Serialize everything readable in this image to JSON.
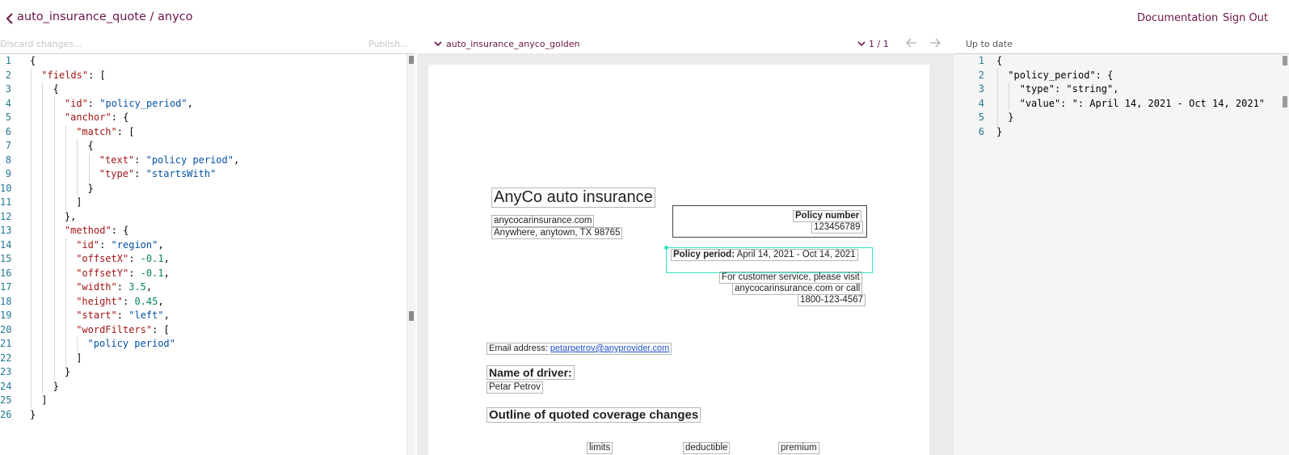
{
  "header": {
    "title": "auto_insurance_quote / anyco",
    "documentation_label": "Documentation",
    "signout_label": "Sign Out"
  },
  "toolbar": {
    "discard_label": "Discard changes...",
    "publish_label": "Publish...",
    "document_name": "auto_insurance_anyco_golden",
    "page_indicator": "1 / 1",
    "status": "Up to date"
  },
  "left_editor": {
    "lines": [
      {
        "n": "1",
        "indent": 0,
        "tokens": [
          [
            "p",
            "{"
          ]
        ]
      },
      {
        "n": "2",
        "indent": 1,
        "tokens": [
          [
            "k",
            "\"fields\""
          ],
          [
            "p",
            ": ["
          ]
        ]
      },
      {
        "n": "3",
        "indent": 2,
        "tokens": [
          [
            "p",
            "{"
          ]
        ]
      },
      {
        "n": "4",
        "indent": 3,
        "tokens": [
          [
            "k",
            "\"id\""
          ],
          [
            "p",
            ": "
          ],
          [
            "s",
            "\"policy_period\""
          ],
          [
            "p",
            ","
          ]
        ]
      },
      {
        "n": "5",
        "indent": 3,
        "tokens": [
          [
            "k",
            "\"anchor\""
          ],
          [
            "p",
            ": {"
          ]
        ]
      },
      {
        "n": "6",
        "indent": 4,
        "tokens": [
          [
            "k",
            "\"match\""
          ],
          [
            "p",
            ": ["
          ]
        ]
      },
      {
        "n": "7",
        "indent": 5,
        "tokens": [
          [
            "p",
            "{"
          ]
        ]
      },
      {
        "n": "8",
        "indent": 6,
        "tokens": [
          [
            "k",
            "\"text\""
          ],
          [
            "p",
            ": "
          ],
          [
            "s",
            "\"policy period\""
          ],
          [
            "p",
            ","
          ]
        ]
      },
      {
        "n": "9",
        "indent": 6,
        "tokens": [
          [
            "k",
            "\"type\""
          ],
          [
            "p",
            ": "
          ],
          [
            "s",
            "\"startsWith\""
          ]
        ]
      },
      {
        "n": "10",
        "indent": 5,
        "tokens": [
          [
            "p",
            "}"
          ]
        ]
      },
      {
        "n": "11",
        "indent": 4,
        "tokens": [
          [
            "p",
            "]"
          ]
        ]
      },
      {
        "n": "12",
        "indent": 3,
        "tokens": [
          [
            "p",
            "},"
          ]
        ]
      },
      {
        "n": "13",
        "indent": 3,
        "tokens": [
          [
            "k",
            "\"method\""
          ],
          [
            "p",
            ": {"
          ]
        ]
      },
      {
        "n": "14",
        "indent": 4,
        "tokens": [
          [
            "k",
            "\"id\""
          ],
          [
            "p",
            ": "
          ],
          [
            "s",
            "\"region\""
          ],
          [
            "p",
            ","
          ]
        ]
      },
      {
        "n": "15",
        "indent": 4,
        "tokens": [
          [
            "k",
            "\"offsetX\""
          ],
          [
            "p",
            ": "
          ],
          [
            "n",
            "-0.1"
          ],
          [
            "p",
            ","
          ]
        ]
      },
      {
        "n": "16",
        "indent": 4,
        "tokens": [
          [
            "k",
            "\"offsetY\""
          ],
          [
            "p",
            ": "
          ],
          [
            "n",
            "-0.1"
          ],
          [
            "p",
            ","
          ]
        ]
      },
      {
        "n": "17",
        "indent": 4,
        "tokens": [
          [
            "k",
            "\"width\""
          ],
          [
            "p",
            ": "
          ],
          [
            "n",
            "3.5"
          ],
          [
            "p",
            ","
          ]
        ]
      },
      {
        "n": "18",
        "indent": 4,
        "tokens": [
          [
            "k",
            "\"height\""
          ],
          [
            "p",
            ": "
          ],
          [
            "n",
            "0.45"
          ],
          [
            "p",
            ","
          ]
        ]
      },
      {
        "n": "19",
        "indent": 4,
        "tokens": [
          [
            "k",
            "\"start\""
          ],
          [
            "p",
            ": "
          ],
          [
            "s",
            "\"left\""
          ],
          [
            "p",
            ","
          ]
        ]
      },
      {
        "n": "20",
        "indent": 4,
        "tokens": [
          [
            "k",
            "\"wordFilters\""
          ],
          [
            "p",
            ": ["
          ]
        ]
      },
      {
        "n": "21",
        "indent": 5,
        "tokens": [
          [
            "s",
            "\"policy period\""
          ]
        ]
      },
      {
        "n": "22",
        "indent": 4,
        "tokens": [
          [
            "p",
            "]"
          ]
        ]
      },
      {
        "n": "23",
        "indent": 3,
        "tokens": [
          [
            "p",
            "}"
          ]
        ]
      },
      {
        "n": "24",
        "indent": 2,
        "tokens": [
          [
            "p",
            "}"
          ]
        ]
      },
      {
        "n": "25",
        "indent": 1,
        "tokens": [
          [
            "p",
            "]"
          ]
        ]
      },
      {
        "n": "26",
        "indent": 0,
        "tokens": [
          [
            "p",
            "}"
          ]
        ]
      }
    ]
  },
  "document": {
    "company": "AnyCo auto insurance",
    "website": "anycocarinsurance.com",
    "address": "Anywhere, anytown, TX 98765",
    "policy_number_label": "Policy number",
    "policy_number": "123456789",
    "policy_period_label": "Policy period:",
    "policy_period_value": " April 14, 2021 - Oct 14, 2021",
    "service_line1": "For customer service, please visit",
    "service_line2": "anycocarinsurance.com or call",
    "service_line3": "1800-123-4567",
    "email_label": "Email address: ",
    "email_value": "petarpetrov@anyprovider.com",
    "driver_label": "Name of driver:",
    "driver_name": "Petar Petrov",
    "coverage_heading": "Outline of quoted coverage changes",
    "col1": "limits",
    "col2": "deductible",
    "col3": "premium"
  },
  "right_editor": {
    "lines": [
      {
        "n": "1",
        "indent": 0,
        "tokens": [
          [
            "p",
            "{"
          ]
        ]
      },
      {
        "n": "2",
        "indent": 1,
        "tokens": [
          [
            "p",
            "\"policy_period\": {"
          ]
        ]
      },
      {
        "n": "3",
        "indent": 2,
        "tokens": [
          [
            "p",
            "\"type\": \"string\","
          ]
        ]
      },
      {
        "n": "4",
        "indent": 2,
        "tokens": [
          [
            "p",
            "\"value\": \": April 14, 2021 - Oct 14, 2021\""
          ]
        ]
      },
      {
        "n": "5",
        "indent": 1,
        "tokens": [
          [
            "p",
            "}"
          ]
        ]
      },
      {
        "n": "6",
        "indent": 0,
        "tokens": [
          [
            "p",
            "}"
          ]
        ]
      }
    ]
  },
  "colors": {
    "accent": "#6b1548",
    "highlight": "#2ee6c0",
    "line_numbers": "#237893"
  }
}
